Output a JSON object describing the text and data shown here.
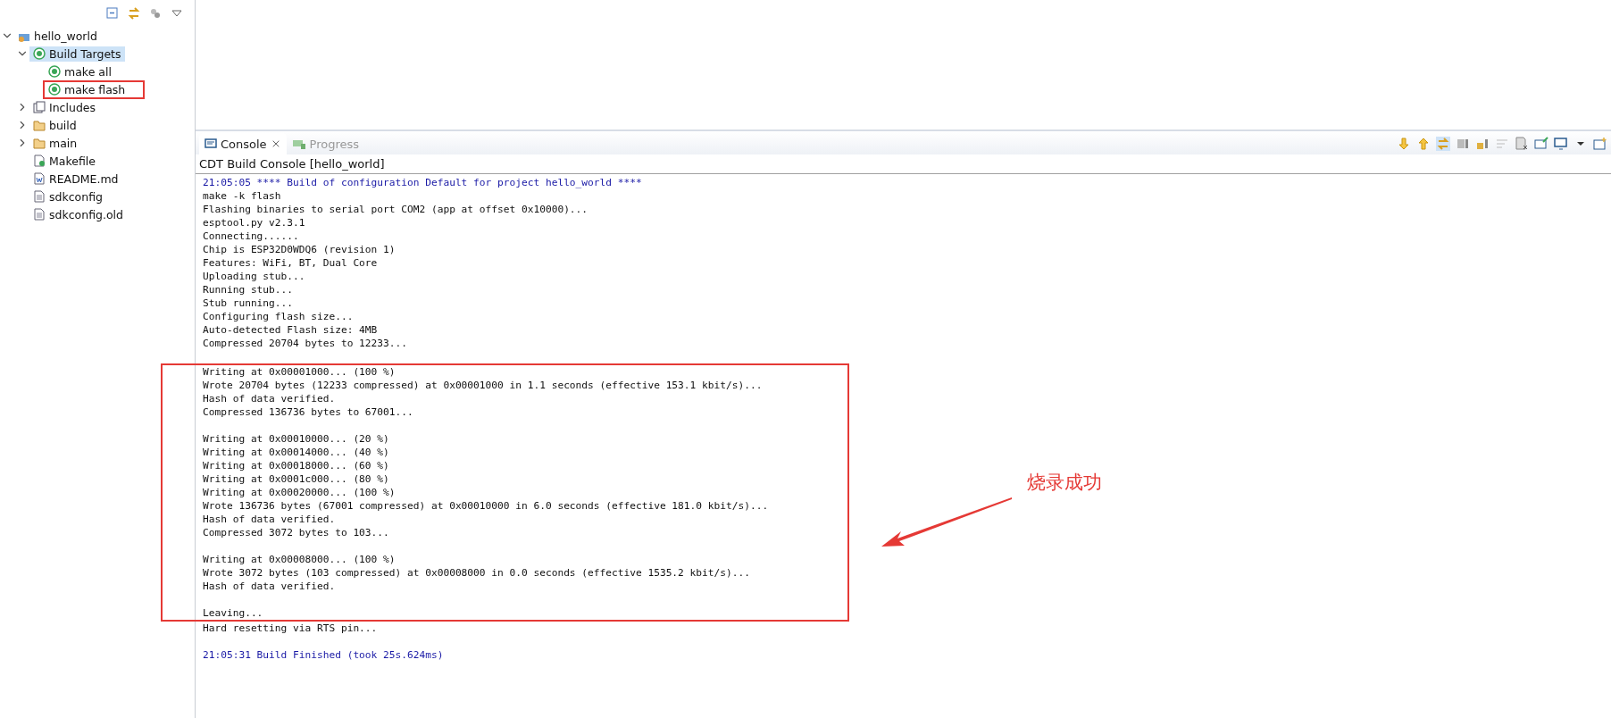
{
  "explorer": {
    "tree": [
      {
        "label": "hello_world",
        "kind": "project",
        "expanded": true,
        "selected": false,
        "highlighted": false,
        "children": [
          {
            "label": "Build Targets",
            "kind": "target",
            "expanded": true,
            "selected": true,
            "highlighted": false,
            "children": [
              {
                "label": "make all",
                "kind": "target",
                "selected": false,
                "highlighted": false
              },
              {
                "label": "make flash",
                "kind": "target",
                "selected": false,
                "highlighted": true
              }
            ]
          },
          {
            "label": "Includes",
            "kind": "includes",
            "expanded": false,
            "selected": false,
            "highlighted": false
          },
          {
            "label": "build",
            "kind": "folder",
            "expanded": false,
            "selected": false,
            "highlighted": false
          },
          {
            "label": "main",
            "kind": "folder",
            "expanded": false,
            "selected": false,
            "highlighted": false
          },
          {
            "label": "Makefile",
            "kind": "makefile",
            "selected": false,
            "highlighted": false
          },
          {
            "label": "README.md",
            "kind": "document",
            "selected": false,
            "highlighted": false
          },
          {
            "label": "sdkconfig",
            "kind": "file",
            "selected": false,
            "highlighted": false
          },
          {
            "label": "sdkconfig.old",
            "kind": "file",
            "selected": false,
            "highlighted": false
          }
        ]
      }
    ]
  },
  "console": {
    "tabs": [
      {
        "label": "Console",
        "selected": true
      },
      {
        "label": "Progress",
        "selected": false
      }
    ],
    "header": "CDT Build Console [hello_world]",
    "blocks": [
      {
        "highlighted": false,
        "lines": [
          {
            "kind": "info",
            "text": "21:05:05 **** Build of configuration Default for project hello_world ****"
          },
          {
            "kind": "plain",
            "text": "make -k flash"
          },
          {
            "kind": "plain",
            "text": "Flashing binaries to serial port COM2 (app at offset 0x10000)..."
          },
          {
            "kind": "plain",
            "text": "esptool.py v2.3.1"
          },
          {
            "kind": "plain",
            "text": "Connecting......"
          },
          {
            "kind": "plain",
            "text": "Chip is ESP32D0WDQ6 (revision 1)"
          },
          {
            "kind": "plain",
            "text": "Features: WiFi, BT, Dual Core"
          },
          {
            "kind": "plain",
            "text": "Uploading stub..."
          },
          {
            "kind": "plain",
            "text": "Running stub..."
          },
          {
            "kind": "plain",
            "text": "Stub running..."
          },
          {
            "kind": "plain",
            "text": "Configuring flash size..."
          },
          {
            "kind": "plain",
            "text": "Auto-detected Flash size: 4MB"
          },
          {
            "kind": "plain",
            "text": "Compressed 20704 bytes to 12233..."
          },
          {
            "kind": "gap"
          }
        ]
      },
      {
        "highlighted": true,
        "lines": [
          {
            "kind": "plain",
            "text": "Writing at 0x00001000... (100 %)"
          },
          {
            "kind": "plain",
            "text": "Wrote 20704 bytes (12233 compressed) at 0x00001000 in 1.1 seconds (effective 153.1 kbit/s)..."
          },
          {
            "kind": "plain",
            "text": "Hash of data verified."
          },
          {
            "kind": "plain",
            "text": "Compressed 136736 bytes to 67001..."
          },
          {
            "kind": "gap"
          },
          {
            "kind": "plain",
            "text": "Writing at 0x00010000... (20 %)"
          },
          {
            "kind": "plain",
            "text": "Writing at 0x00014000... (40 %)"
          },
          {
            "kind": "plain",
            "text": "Writing at 0x00018000... (60 %)"
          },
          {
            "kind": "plain",
            "text": "Writing at 0x0001c000... (80 %)"
          },
          {
            "kind": "plain",
            "text": "Writing at 0x00020000... (100 %)"
          },
          {
            "kind": "plain",
            "text": "Wrote 136736 bytes (67001 compressed) at 0x00010000 in 6.0 seconds (effective 181.0 kbit/s)..."
          },
          {
            "kind": "plain",
            "text": "Hash of data verified."
          },
          {
            "kind": "plain",
            "text": "Compressed 3072 bytes to 103..."
          },
          {
            "kind": "gap"
          },
          {
            "kind": "plain",
            "text": "Writing at 0x00008000... (100 %)"
          },
          {
            "kind": "plain",
            "text": "Wrote 3072 bytes (103 compressed) at 0x00008000 in 0.0 seconds (effective 1535.2 kbit/s)..."
          },
          {
            "kind": "plain",
            "text": "Hash of data verified."
          },
          {
            "kind": "gap"
          },
          {
            "kind": "plain",
            "text": "Leaving..."
          }
        ]
      },
      {
        "highlighted": false,
        "lines": [
          {
            "kind": "plain",
            "text": "Hard resetting via RTS pin..."
          },
          {
            "kind": "gap"
          },
          {
            "kind": "info",
            "text": "21:05:31 Build Finished (took 25s.624ms)"
          }
        ]
      }
    ]
  },
  "annotation": {
    "text": "烧录成功"
  }
}
